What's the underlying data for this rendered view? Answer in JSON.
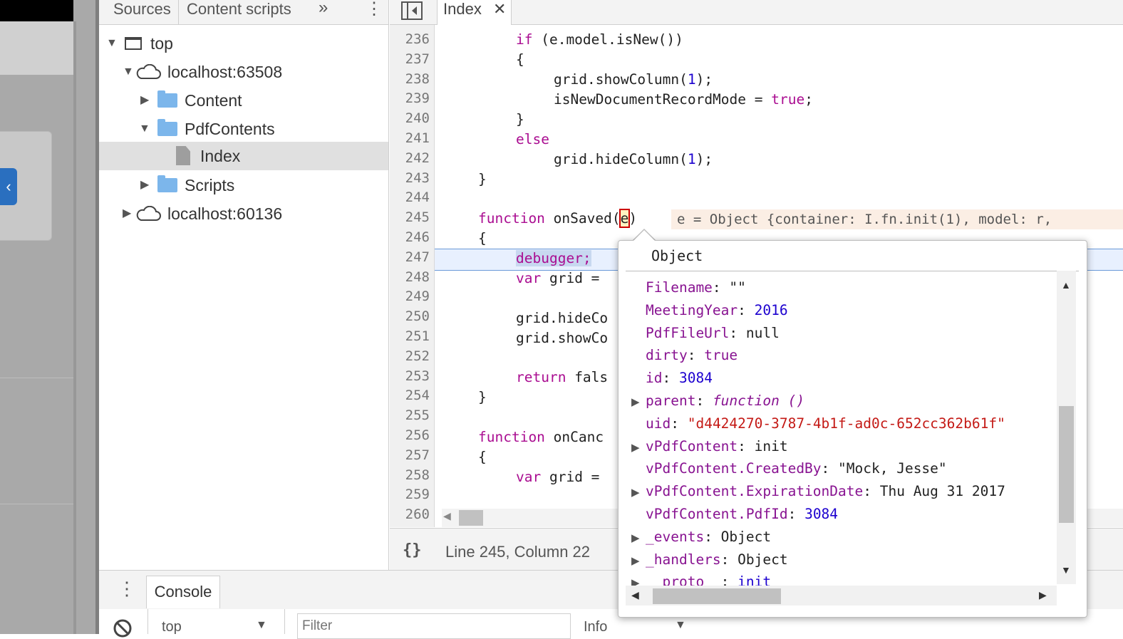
{
  "navigator": {
    "tabs": [
      "Sources",
      "Content scripts"
    ],
    "more_label": "»",
    "tree": [
      {
        "label": "top"
      },
      {
        "label": "localhost:63508"
      },
      {
        "label": "Content"
      },
      {
        "label": "PdfContents"
      },
      {
        "label": "Index"
      },
      {
        "label": "Scripts"
      },
      {
        "label": "localhost:60136"
      }
    ]
  },
  "editor": {
    "tab_label": "Index",
    "line_numbers": [
      "236",
      "237",
      "238",
      "239",
      "240",
      "241",
      "242",
      "243",
      "244",
      "245",
      "246",
      "247",
      "248",
      "249",
      "250",
      "251",
      "252",
      "253",
      "254",
      "255",
      "256",
      "257",
      "258",
      "259",
      "260"
    ],
    "code": {
      "l236_kw": "if",
      "l236_rest": " (e.model.isNew())",
      "l237": "{",
      "l238_a": "grid.showColumn(",
      "l238_n": "1",
      "l238_b": ");",
      "l239_a": "isNewDocumentRecordMode = ",
      "l239_kw": "true",
      "l239_b": ";",
      "l240": "}",
      "l241": "else",
      "l242_a": "grid.hideColumn(",
      "l242_n": "1",
      "l242_b": ");",
      "l243": "}",
      "l245_kw": "function",
      "l245_a": " onSaved(",
      "l245_p": "e",
      "l245_b": ")",
      "l246": "{",
      "l247": "debugger;",
      "l248_kw": "var",
      "l248_rest": " grid = ",
      "l250": "grid.hideCo",
      "l251": "grid.showCo",
      "l253_kw": "return",
      "l253_rest": " fals",
      "l254": "}",
      "l256_kw": "function",
      "l256_rest": " onCanc",
      "l257": "{",
      "l258_kw": "var",
      "l258_rest": " grid = "
    },
    "inline_value": "e = Object {container: I.fn.init(1), model: r,",
    "status": "Line 245, Column 22",
    "format_icon": "{}"
  },
  "popover": {
    "title": "Object",
    "props": [
      {
        "key": "Filename",
        "value": "\"\""
      },
      {
        "key": "MeetingYear",
        "value": "2016"
      },
      {
        "key": "PdfFileUrl",
        "value": "null"
      },
      {
        "key": "dirty",
        "value": "true"
      },
      {
        "key": "id",
        "value": "3084"
      },
      {
        "key": "parent",
        "value": "function ()"
      },
      {
        "key": "uid",
        "value": "\"d4424270-3787-4b1f-ad0c-652cc362b61f\""
      },
      {
        "key": "vPdfContent",
        "value": "init"
      },
      {
        "key": "vPdfContent.CreatedBy",
        "value": "\"Mock, Jesse\""
      },
      {
        "key": "vPdfContent.ExpirationDate",
        "value": "Thu Aug 31 2017"
      },
      {
        "key": "vPdfContent.PdfId",
        "value": "3084"
      },
      {
        "key": "_events",
        "value": "Object"
      },
      {
        "key": "_handlers",
        "value": "Object"
      },
      {
        "key": "__proto__",
        "value": "init"
      }
    ]
  },
  "drawer": {
    "tab_label": "Console",
    "context": "top",
    "filter_placeholder": "Filter",
    "level": "Info"
  }
}
